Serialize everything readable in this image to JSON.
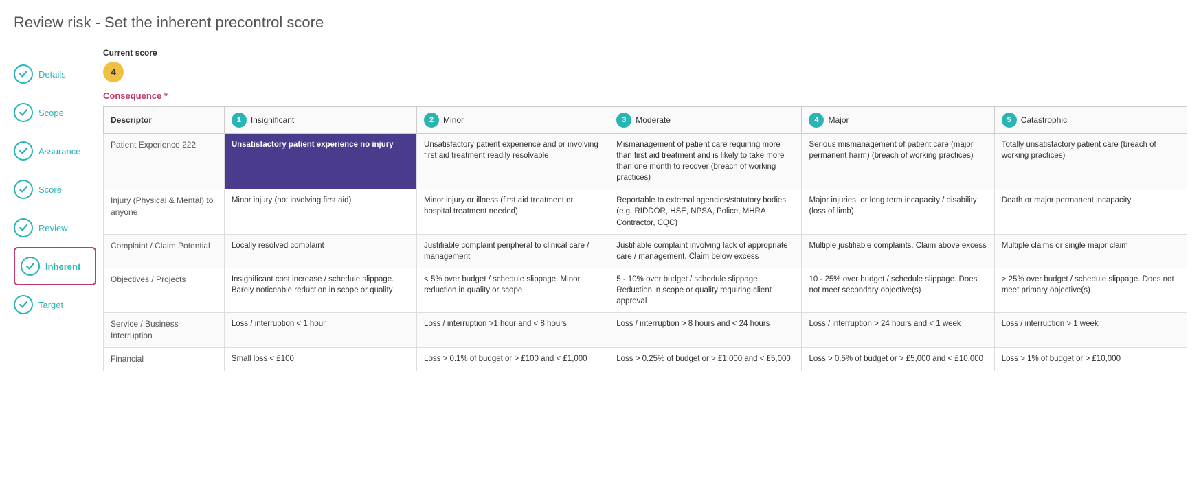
{
  "page": {
    "title": "Review risk - Set the inherent precontrol score"
  },
  "sidebar": {
    "items": [
      {
        "id": "details",
        "label": "Details",
        "active": false
      },
      {
        "id": "scope",
        "label": "Scope",
        "active": false
      },
      {
        "id": "assurance",
        "label": "Assurance",
        "active": false
      },
      {
        "id": "score",
        "label": "Score",
        "active": false
      },
      {
        "id": "review",
        "label": "Review",
        "active": false
      },
      {
        "id": "inherent",
        "label": "Inherent",
        "active": true
      },
      {
        "id": "target",
        "label": "Target",
        "active": false
      }
    ]
  },
  "score_section": {
    "current_score_label": "Current score",
    "current_score_value": "4",
    "consequence_label": "Consequence",
    "required_marker": "*"
  },
  "table": {
    "header": {
      "descriptor": "Descriptor",
      "columns": [
        {
          "num": "1",
          "label": "Insignificant"
        },
        {
          "num": "2",
          "label": "Minor"
        },
        {
          "num": "3",
          "label": "Moderate"
        },
        {
          "num": "4",
          "label": "Major"
        },
        {
          "num": "5",
          "label": "Catastrophic"
        }
      ]
    },
    "rows": [
      {
        "descriptor": "Patient Experience 222",
        "cells": [
          {
            "text": "Unsatisfactory patient experience no injury",
            "selected": true
          },
          {
            "text": "Unsatisfactory patient experience and or involving first aid treatment readily resolvable",
            "selected": false
          },
          {
            "text": "Mismanagement of patient care requiring more than first aid treatment and is likely to take more than one month to recover (breach of working practices)",
            "selected": false
          },
          {
            "text": "Serious mismanagement of patient care (major permanent harm) (breach of working practices)",
            "selected": false
          },
          {
            "text": "Totally unsatisfactory patient care (breach of working practices)",
            "selected": false
          }
        ]
      },
      {
        "descriptor": "Injury (Physical & Mental) to anyone",
        "cells": [
          {
            "text": "Minor injury (not involving first aid)",
            "selected": false
          },
          {
            "text": "Minor injury or illness (first aid treatment or hospital treatment needed)",
            "selected": false
          },
          {
            "text": "Reportable to external agencies/statutory bodies (e.g. RIDDOR, HSE, NPSA, Police, MHRA Contractor, CQC)",
            "selected": false
          },
          {
            "text": "Major injuries, or long term incapacity / disability (loss of limb)",
            "selected": false
          },
          {
            "text": "Death or major permanent incapacity",
            "selected": false
          }
        ]
      },
      {
        "descriptor": "Complaint / Claim Potential",
        "cells": [
          {
            "text": "Locally resolved complaint",
            "selected": false
          },
          {
            "text": "Justifiable complaint peripheral to clinical care / management",
            "selected": false
          },
          {
            "text": "Justifiable complaint involving lack of appropriate care / management. Claim below excess",
            "selected": false
          },
          {
            "text": "Multiple justifiable complaints. Claim above excess",
            "selected": false
          },
          {
            "text": "Multiple claims or single major claim",
            "selected": false
          }
        ]
      },
      {
        "descriptor": "Objectives / Projects",
        "cells": [
          {
            "text": "Insignificant cost increase / schedule slippage. Barely noticeable reduction in scope or quality",
            "selected": false
          },
          {
            "text": "< 5% over budget / schedule slippage. Minor reduction in quality or scope",
            "selected": false
          },
          {
            "text": "5 - 10% over budget / schedule slippage. Reduction in scope or quality requiring client approval",
            "selected": false
          },
          {
            "text": "10 - 25% over budget / schedule slippage. Does not meet secondary objective(s)",
            "selected": false
          },
          {
            "text": "> 25% over budget / schedule slippage. Does not meet primary objective(s)",
            "selected": false
          }
        ]
      },
      {
        "descriptor": "Service / Business Interruption",
        "cells": [
          {
            "text": "Loss / interruption < 1 hour",
            "selected": false
          },
          {
            "text": "Loss / interruption >1 hour and < 8 hours",
            "selected": false
          },
          {
            "text": "Loss / interruption > 8 hours and < 24 hours",
            "selected": false
          },
          {
            "text": "Loss / interruption > 24 hours and < 1 week",
            "selected": false
          },
          {
            "text": "Loss / interruption > 1 week",
            "selected": false
          }
        ]
      },
      {
        "descriptor": "Financial",
        "cells": [
          {
            "text": "Small loss < £100",
            "selected": false
          },
          {
            "text": "Loss > 0.1% of budget or > £100 and < £1,000",
            "selected": false
          },
          {
            "text": "Loss > 0.25% of budget or > £1,000 and < £5,000",
            "selected": false
          },
          {
            "text": "Loss > 0.5% of budget or > £5,000 and < £10,000",
            "selected": false
          },
          {
            "text": "Loss > 1% of budget or > £10,000",
            "selected": false
          }
        ]
      }
    ]
  }
}
